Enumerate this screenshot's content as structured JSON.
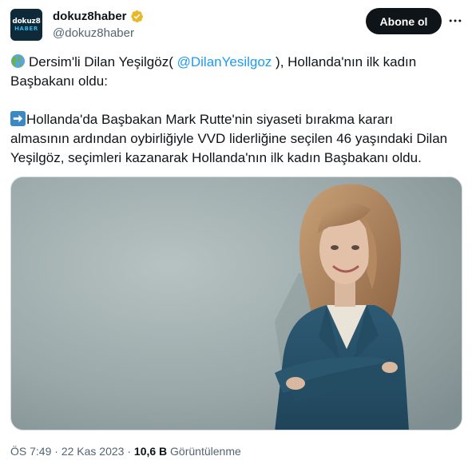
{
  "account": {
    "name": "dokuz8haber",
    "handle": "@dokuz8haber",
    "avatar_line1": "dokuz8",
    "avatar_line2": "HABER",
    "verified_icon": "gold-checkmark-badge",
    "verified_color": "#e8b828"
  },
  "actions": {
    "follow_label": "Abone ol",
    "more_icon": "more-horizontal-icon"
  },
  "tweet": {
    "line1_prefix": "Dersim'li Dilan Yeşilgöz(",
    "mention": "@DilanYesilgoz",
    "line1_suffix": "), Hollanda'nın ilk kadın",
    "line2": "Başbakanı oldu:",
    "line3": "Hollanda'da Başbakan Mark Rutte'nin siyaseti bırakma kararı",
    "line4": "almasının ardından oybirliğiyle VVD liderliğine seçilen 46 yaşındaki Dilan",
    "line5": "Yeşilgöz, seçimleri kazanarak  Hollanda'nın ilk kadın Başbakanı oldu.",
    "globe_icon": "globe-emoji",
    "arrow_icon": "right-arrow-emoji"
  },
  "media": {
    "image": "photo-woman-in-blue-suit-arms-crossed"
  },
  "meta": {
    "time": "ÖS 7:49",
    "sep1": "·",
    "date": "22 Kas 2023",
    "sep2": "·",
    "views": "10,6 B",
    "views_label": "Görüntülenme"
  },
  "colors": {
    "link": "#1d9bf0",
    "muted": "#536471",
    "text": "#0f1419",
    "button": "#0f1419"
  }
}
